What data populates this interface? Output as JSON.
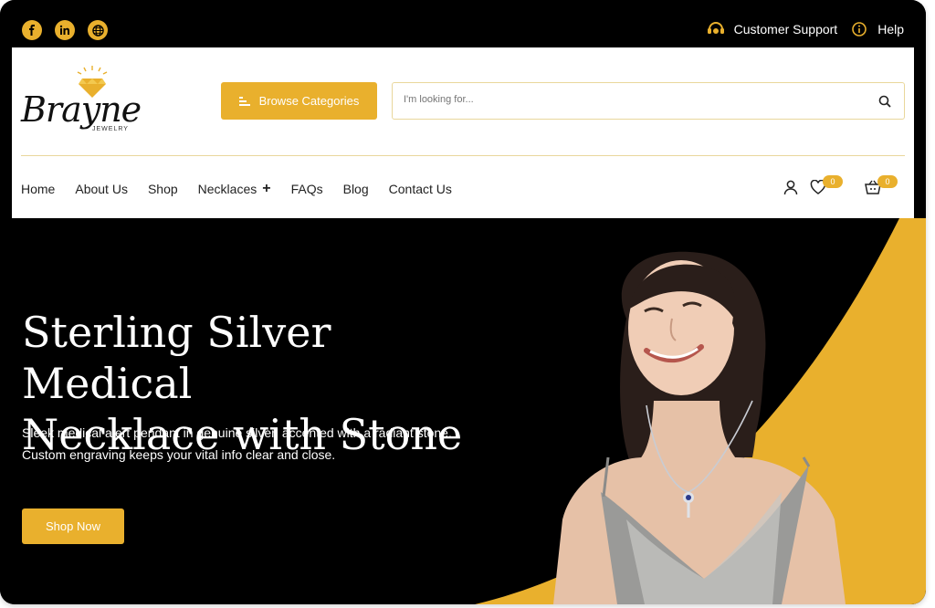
{
  "topbar": {
    "social": [
      "facebook-icon",
      "linkedin-icon",
      "globe-icon"
    ],
    "customer_support": "Customer Support",
    "help": "Help"
  },
  "header": {
    "logo_text": "Brayne",
    "logo_sub": "JEWELRY",
    "browse_label": "Browse Categories",
    "search_placeholder": "I'm looking for..."
  },
  "nav": {
    "items": [
      "Home",
      "About Us",
      "Shop",
      "Necklaces",
      "FAQs",
      "Blog",
      "Contact Us"
    ],
    "wishlist_count": "0",
    "cart_count": "0"
  },
  "hero": {
    "title_line1": "Sterling Silver Medical",
    "title_line2": "Necklace with Stone",
    "lead": "Sleek medical alert pendant in genuine silver, accented with a radiant stone. Custom engraving keeps your vital info clear and close.",
    "cta": "Shop Now"
  },
  "colors": {
    "accent": "#e9b02d",
    "dark": "#000000",
    "light": "#ffffff"
  }
}
